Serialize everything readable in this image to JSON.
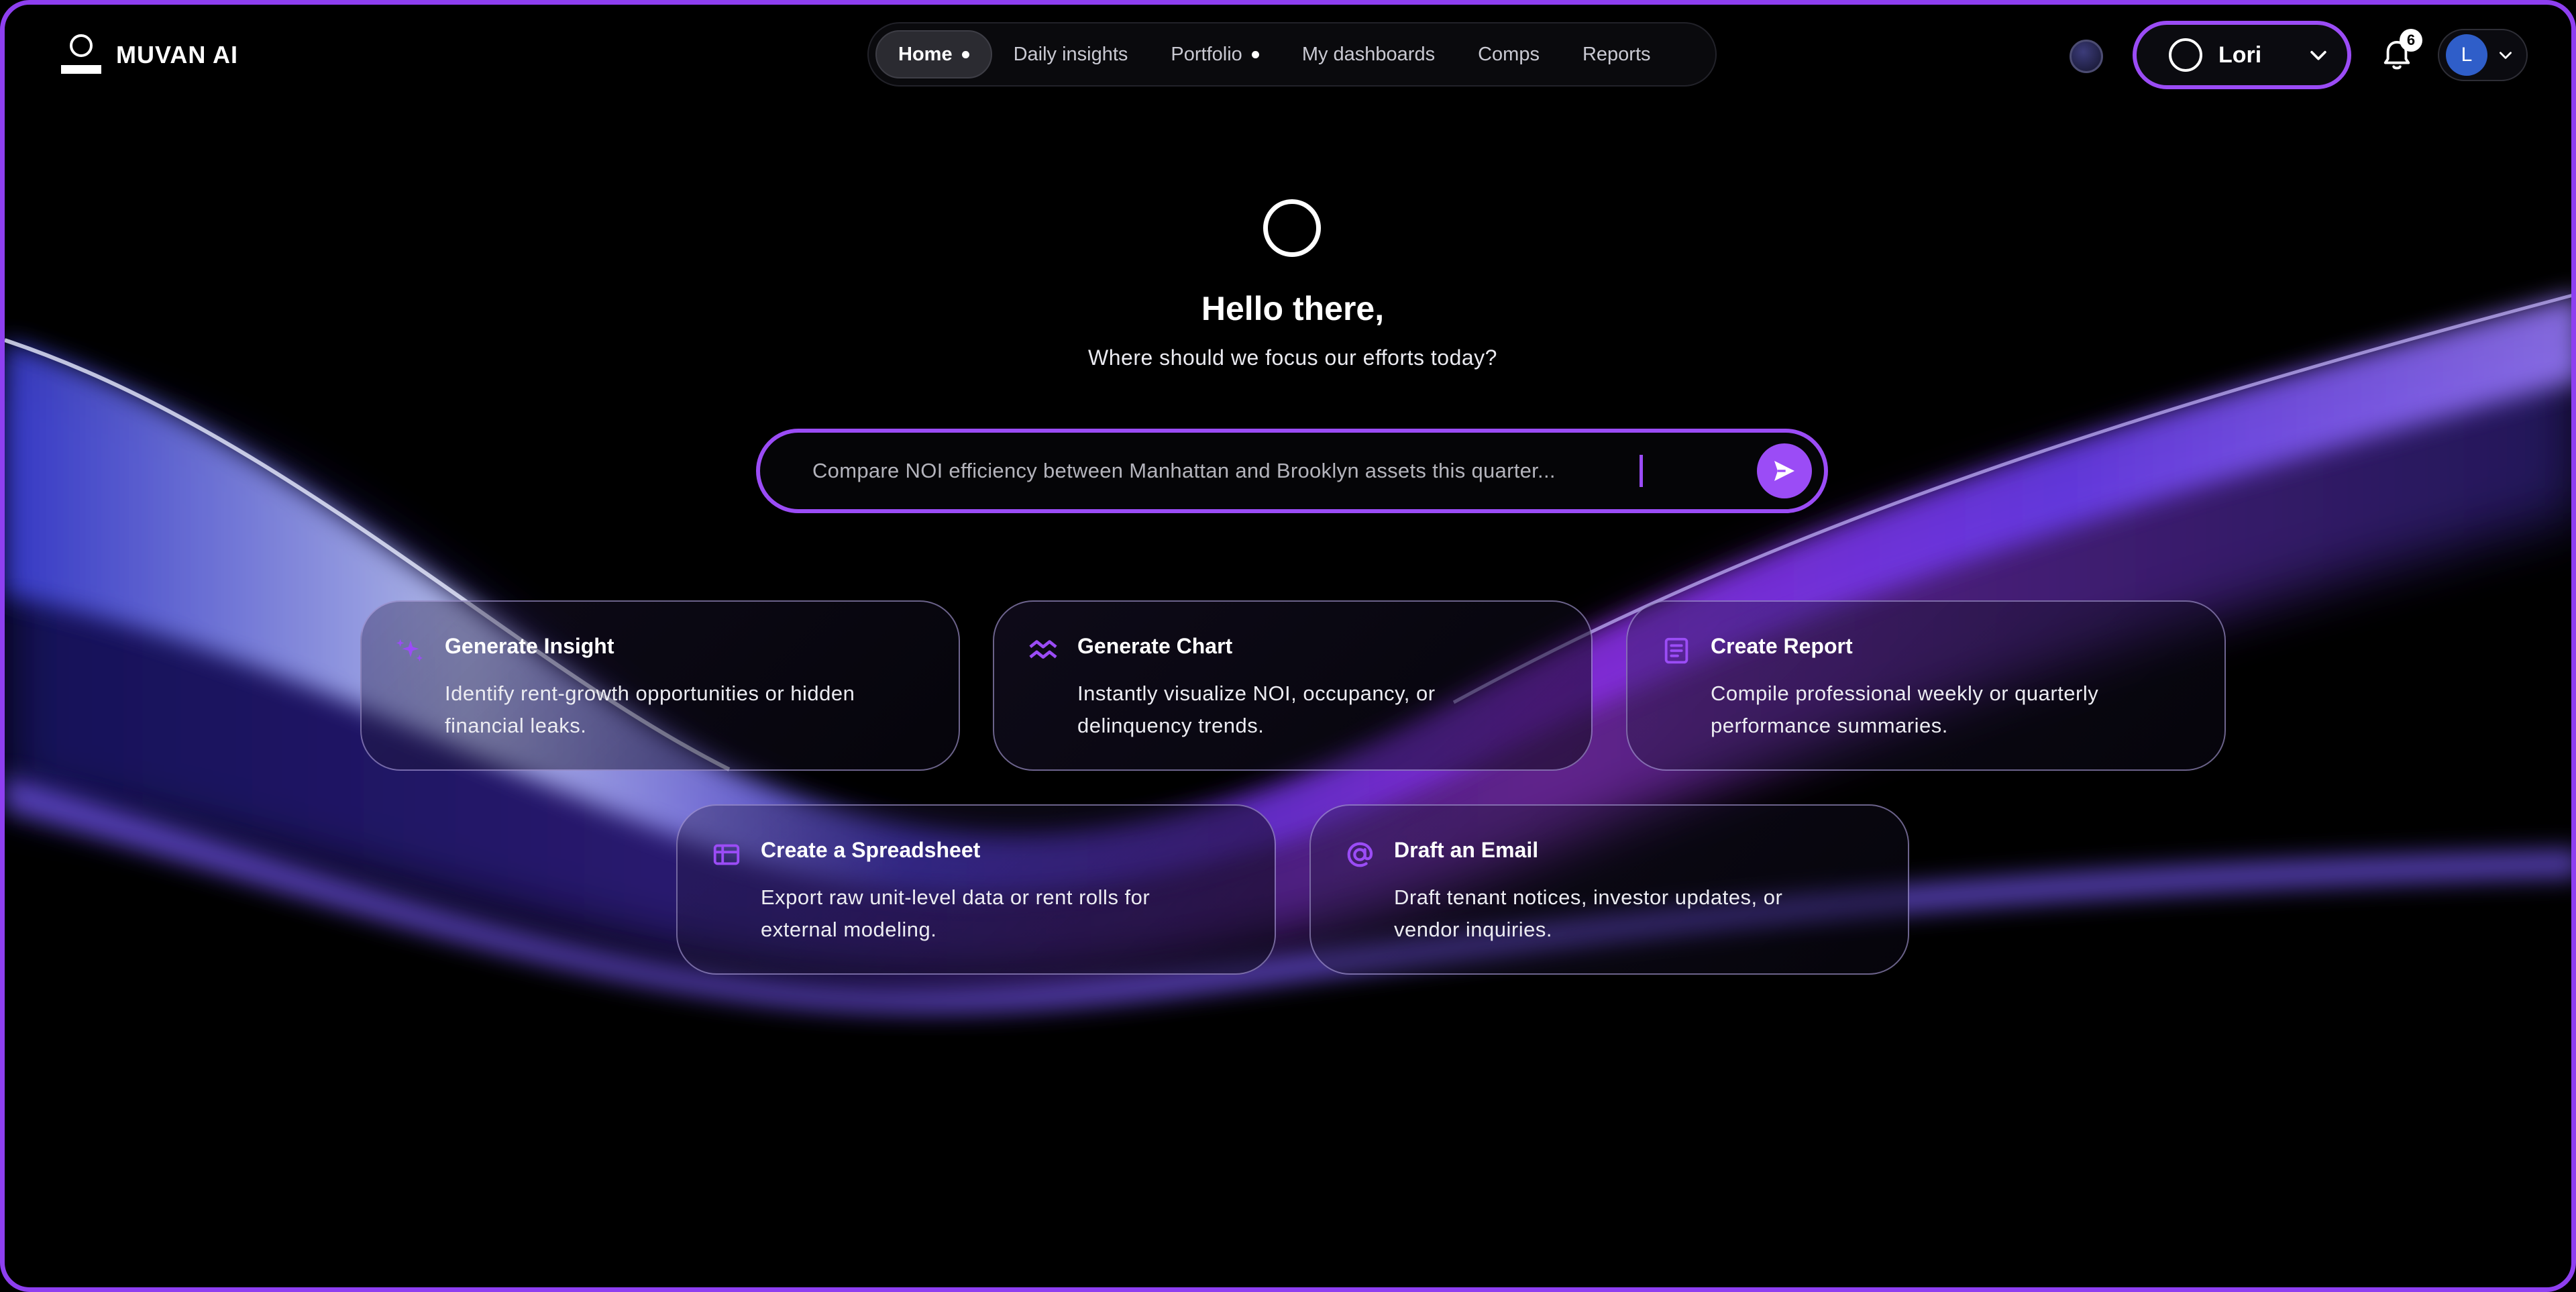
{
  "brand": {
    "name": "MUVAN AI"
  },
  "nav": {
    "items": [
      {
        "label": "Home",
        "active": true,
        "dot": true
      },
      {
        "label": "Daily insights",
        "active": false,
        "dot": false
      },
      {
        "label": "Portfolio",
        "active": false,
        "dot": true
      },
      {
        "label": "My dashboards",
        "active": false,
        "dot": false
      },
      {
        "label": "Comps",
        "active": false,
        "dot": false
      },
      {
        "label": "Reports",
        "active": false,
        "dot": false
      }
    ]
  },
  "header": {
    "user_name": "Lori",
    "notification_count": "6",
    "avatar_initial": "L"
  },
  "hero": {
    "greeting": "Hello there,",
    "subtitle": "Where should we focus our efforts today?"
  },
  "search": {
    "placeholder": "Compare NOI efficiency between Manhattan and Brooklyn assets this quarter..."
  },
  "cards": [
    {
      "title": "Generate Insight",
      "desc_1": "Identify rent-growth opportunities or hidden",
      "desc_2": "financial leaks.",
      "icon": "sparkles-icon"
    },
    {
      "title": "Generate Chart",
      "desc_1": "Instantly visualize NOI, occupancy, or",
      "desc_2": "delinquency trends.",
      "icon": "chart-trend-icon"
    },
    {
      "title": "Create Report",
      "desc_1": "Compile professional weekly or quarterly",
      "desc_2": "performance summaries.",
      "icon": "document-icon"
    },
    {
      "title": "Create a Spreadsheet",
      "desc_1": "Export raw unit-level data or rent rolls for",
      "desc_2": "external modeling.",
      "icon": "spreadsheet-icon"
    },
    {
      "title": "Draft an Email",
      "desc_1": "Draft tenant notices, investor updates, or",
      "desc_2": "vendor inquiries.",
      "icon": "at-sign-icon"
    }
  ],
  "colors": {
    "accent": "#9b4cf6",
    "frame": "#8e3ff0",
    "background": "#000000"
  }
}
